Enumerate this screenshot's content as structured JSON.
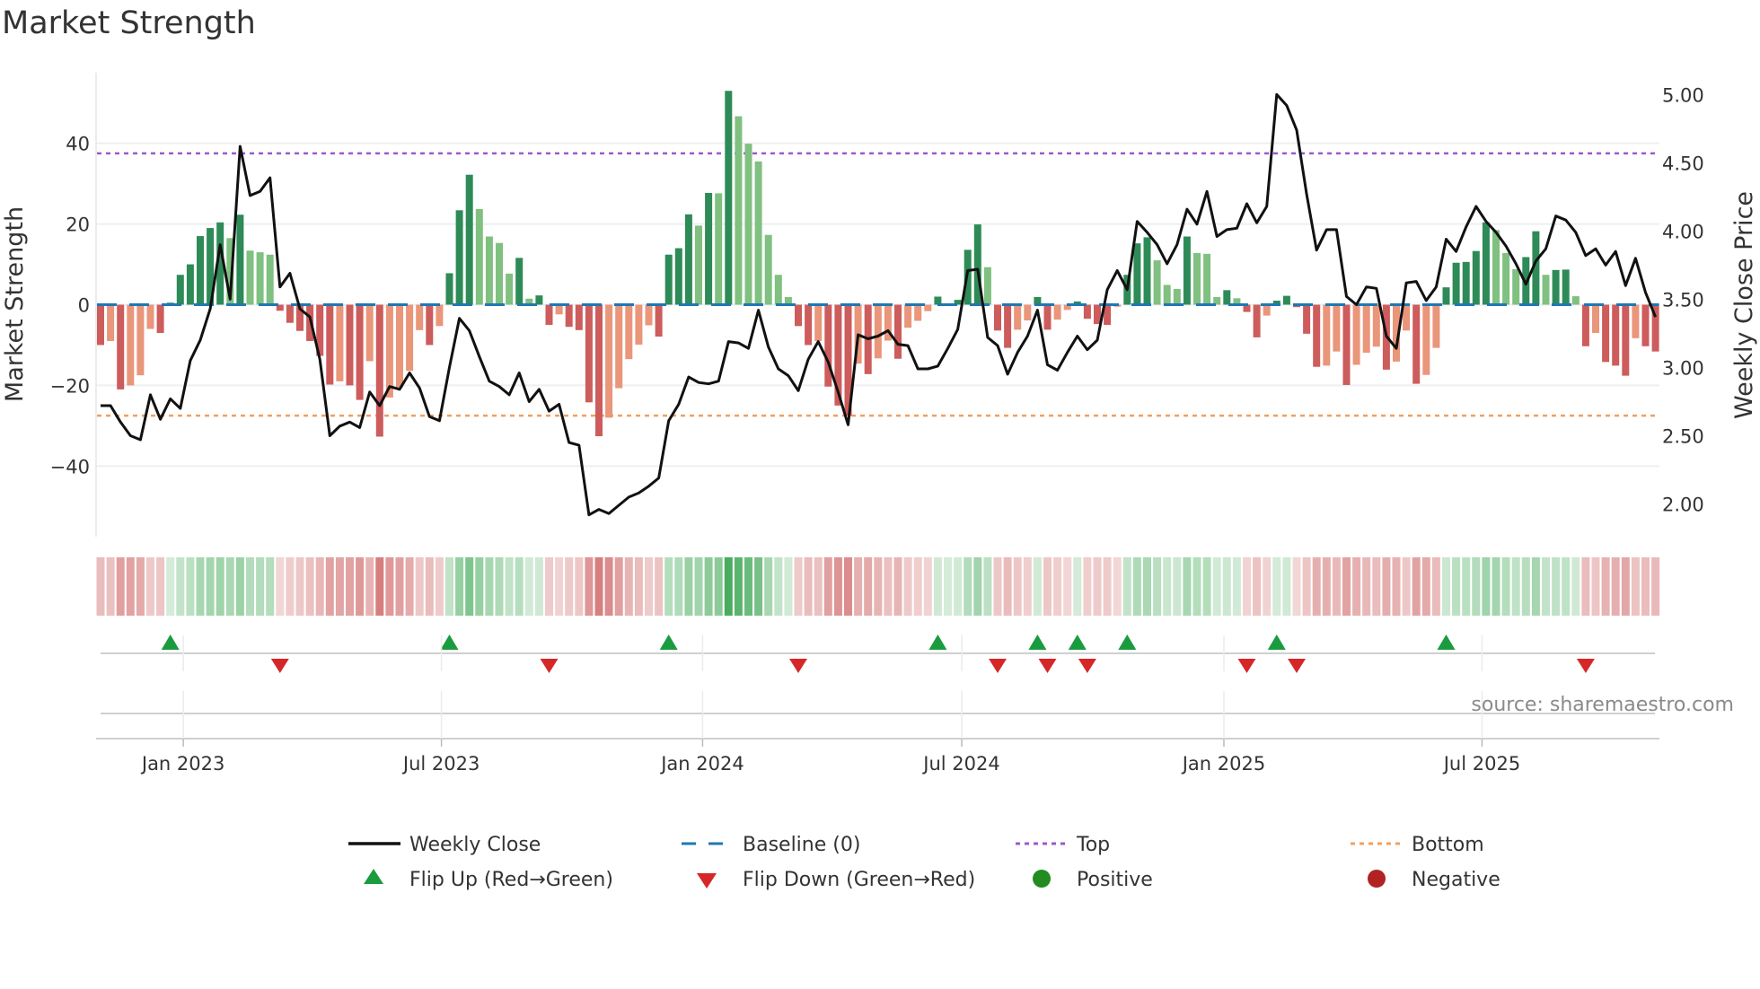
{
  "title": "Market Strength",
  "source": "source: sharemaestro.com",
  "colors": {
    "bar_pos_strong": "#2e8b57",
    "bar_pos_weak": "#80c080",
    "bar_neg_strong": "#cd5c5c",
    "bar_neg_weak": "#e9967a",
    "baseline": "#1f77b4",
    "top": "#9b59d0",
    "bottom": "#f0a060",
    "close": "#111111",
    "flip_up": "#1a9c3e",
    "flip_down": "#d62728",
    "positive": "#228b22",
    "negative": "#b22222"
  },
  "legend": [
    {
      "key": "close",
      "label": "Weekly Close"
    },
    {
      "key": "baseline",
      "label": "Baseline (0)"
    },
    {
      "key": "top",
      "label": "Top"
    },
    {
      "key": "bottom",
      "label": "Bottom"
    },
    {
      "key": "flip_up",
      "label": "Flip Up (Red→Green)"
    },
    {
      "key": "flip_down",
      "label": "Flip Down (Green→Red)"
    },
    {
      "key": "positive",
      "label": "Positive"
    },
    {
      "key": "negative",
      "label": "Negative"
    }
  ],
  "chart_data": {
    "type": "bar+line",
    "ylabel": "Market Strength",
    "y2label": "Weekly Close Price",
    "ylim": [
      -57.5,
      57.5
    ],
    "y2lim": [
      1.76,
      5.16
    ],
    "yticks": [
      40,
      20,
      0,
      -20,
      -40
    ],
    "ytick_labels": [
      "40",
      "20",
      "0",
      "−20",
      "−40"
    ],
    "y2ticks": [
      5.0,
      4.5,
      4.0,
      3.5,
      3.0,
      2.5,
      2.0
    ],
    "y2tick_labels": [
      "5.00",
      "4.50",
      "4.00",
      "3.50",
      "3.00",
      "2.50",
      "2.00"
    ],
    "x_unit": "week index",
    "xticks": [
      8.3,
      34.2,
      60.4,
      86.4,
      112.7,
      138.6
    ],
    "xtick_labels": [
      "Jan 2023",
      "Jul 2023",
      "Jan 2024",
      "Jul 2024",
      "Jan 2025",
      "Jul 2025"
    ],
    "top_level": 37.5,
    "bottom_level": -27.5,
    "baseline": 0,
    "strength": [
      -10,
      -9,
      -21,
      -20,
      -17.5,
      -6,
      -7,
      0.5,
      7.4,
      10,
      17,
      19,
      20.4,
      16.5,
      22.3,
      13.4,
      13,
      12.4,
      -1.5,
      -4.5,
      -6.5,
      -9,
      -12.7,
      -19.8,
      -19,
      -20,
      -23.6,
      -14,
      -32.7,
      -23,
      -20.5,
      -16.4,
      -6.3,
      -10,
      -5.3,
      7.8,
      23.4,
      32.2,
      23.7,
      16.9,
      15.3,
      7.7,
      11.6,
      1.5,
      2.3,
      -5,
      -2.4,
      -5.5,
      -6.3,
      -24.2,
      -32.6,
      -28,
      -20.7,
      -13.5,
      -9.9,
      -5.1,
      -7.9,
      12.4,
      14,
      22.4,
      19.6,
      27.7,
      27.6,
      53,
      46.7,
      39.9,
      35.5,
      17.3,
      7.4,
      1.9,
      -5.3,
      -10,
      -9,
      -20.3,
      -25,
      -27.5,
      -14.6,
      -17.2,
      -13.3,
      -8.9,
      -13.4,
      -5.7,
      -4,
      -1.6,
      2,
      0.3,
      1.2,
      13.6,
      19.9,
      9.3,
      -6.4,
      -10.7,
      -6.2,
      -3.9,
      1.9,
      -6.2,
      -3.7,
      -1.3,
      0.8,
      -3.5,
      -4.8,
      -5,
      -0.5,
      7.4,
      15.2,
      16.7,
      11,
      4.9,
      3.9,
      16.9,
      12.8,
      12.6,
      1.9,
      3.6,
      1.6,
      -1.8,
      -8.1,
      -2.7,
      1.0,
      2.2,
      -0.6,
      -7.2,
      -15.4,
      -15.1,
      -11.6,
      -19.9,
      -14.9,
      -11.9,
      -10.4,
      -16.1,
      -14.1,
      -6.4,
      -19.6,
      -17.4,
      -10.7,
      4.3,
      10.4,
      10.6,
      13.3,
      20.4,
      18.5,
      12.8,
      8.8,
      11.8,
      18.2,
      7.4,
      8.6,
      8.7,
      2.1,
      -10.3,
      -7,
      -14.2,
      -15.1,
      -17.6,
      -8.3,
      -10.3,
      -11.6
    ],
    "close": [
      2.72,
      2.72,
      2.6,
      2.5,
      2.47,
      2.8,
      2.62,
      2.77,
      2.7,
      3.05,
      3.2,
      3.43,
      3.9,
      3.5,
      4.62,
      4.26,
      4.29,
      4.39,
      3.59,
      3.69,
      3.43,
      3.37,
      3.06,
      2.5,
      2.57,
      2.6,
      2.56,
      2.82,
      2.72,
      2.86,
      2.84,
      2.96,
      2.85,
      2.64,
      2.61,
      3.0,
      3.36,
      3.27,
      3.08,
      2.9,
      2.86,
      2.8,
      2.96,
      2.75,
      2.84,
      2.68,
      2.73,
      2.45,
      2.43,
      1.92,
      1.96,
      1.93,
      1.99,
      2.05,
      2.08,
      2.13,
      2.19,
      2.61,
      2.73,
      2.93,
      2.89,
      2.88,
      2.9,
      3.19,
      3.18,
      3.14,
      3.42,
      3.15,
      2.99,
      2.94,
      2.83,
      3.06,
      3.19,
      3.04,
      2.82,
      2.58,
      3.24,
      3.21,
      3.23,
      3.27,
      3.17,
      3.16,
      2.99,
      2.99,
      3.01,
      3.14,
      3.28,
      3.71,
      3.72,
      3.22,
      3.16,
      2.95,
      3.11,
      3.23,
      3.42,
      3.02,
      2.98,
      3.11,
      3.23,
      3.13,
      3.2,
      3.57,
      3.71,
      3.57,
      4.07,
      3.99,
      3.9,
      3.76,
      3.9,
      4.16,
      4.05,
      4.29,
      3.96,
      4.01,
      4.02,
      4.2,
      4.06,
      4.18,
      5.0,
      4.92,
      4.74,
      4.27,
      3.86,
      4.01,
      4.01,
      3.52,
      3.46,
      3.59,
      3.58,
      3.23,
      3.14,
      3.62,
      3.63,
      3.49,
      3.59,
      3.94,
      3.85,
      4.03,
      4.18,
      4.07,
      3.99,
      3.89,
      3.76,
      3.61,
      3.78,
      3.87,
      4.11,
      4.08,
      3.99,
      3.82,
      3.87,
      3.75,
      3.85,
      3.6,
      3.8,
      3.55,
      3.37
    ],
    "flip_up_weeks": [
      7,
      35,
      57,
      84,
      94,
      98,
      103,
      118,
      135
    ],
    "flip_down_weeks": [
      18,
      45,
      70,
      90,
      95,
      99,
      115,
      120,
      149
    ],
    "legend_position": "bottom"
  }
}
